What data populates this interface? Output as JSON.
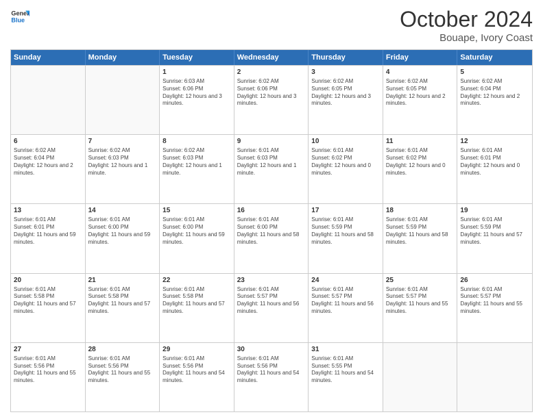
{
  "header": {
    "logo_general": "General",
    "logo_blue": "Blue",
    "month": "October 2024",
    "location": "Bouape, Ivory Coast"
  },
  "days_of_week": [
    "Sunday",
    "Monday",
    "Tuesday",
    "Wednesday",
    "Thursday",
    "Friday",
    "Saturday"
  ],
  "rows": [
    [
      {
        "day": "",
        "empty": true
      },
      {
        "day": "",
        "empty": true
      },
      {
        "day": "1",
        "sunrise": "Sunrise: 6:03 AM",
        "sunset": "Sunset: 6:06 PM",
        "daylight": "Daylight: 12 hours and 3 minutes."
      },
      {
        "day": "2",
        "sunrise": "Sunrise: 6:02 AM",
        "sunset": "Sunset: 6:06 PM",
        "daylight": "Daylight: 12 hours and 3 minutes."
      },
      {
        "day": "3",
        "sunrise": "Sunrise: 6:02 AM",
        "sunset": "Sunset: 6:05 PM",
        "daylight": "Daylight: 12 hours and 3 minutes."
      },
      {
        "day": "4",
        "sunrise": "Sunrise: 6:02 AM",
        "sunset": "Sunset: 6:05 PM",
        "daylight": "Daylight: 12 hours and 2 minutes."
      },
      {
        "day": "5",
        "sunrise": "Sunrise: 6:02 AM",
        "sunset": "Sunset: 6:04 PM",
        "daylight": "Daylight: 12 hours and 2 minutes."
      }
    ],
    [
      {
        "day": "6",
        "sunrise": "Sunrise: 6:02 AM",
        "sunset": "Sunset: 6:04 PM",
        "daylight": "Daylight: 12 hours and 2 minutes."
      },
      {
        "day": "7",
        "sunrise": "Sunrise: 6:02 AM",
        "sunset": "Sunset: 6:03 PM",
        "daylight": "Daylight: 12 hours and 1 minute."
      },
      {
        "day": "8",
        "sunrise": "Sunrise: 6:02 AM",
        "sunset": "Sunset: 6:03 PM",
        "daylight": "Daylight: 12 hours and 1 minute."
      },
      {
        "day": "9",
        "sunrise": "Sunrise: 6:01 AM",
        "sunset": "Sunset: 6:03 PM",
        "daylight": "Daylight: 12 hours and 1 minute."
      },
      {
        "day": "10",
        "sunrise": "Sunrise: 6:01 AM",
        "sunset": "Sunset: 6:02 PM",
        "daylight": "Daylight: 12 hours and 0 minutes."
      },
      {
        "day": "11",
        "sunrise": "Sunrise: 6:01 AM",
        "sunset": "Sunset: 6:02 PM",
        "daylight": "Daylight: 12 hours and 0 minutes."
      },
      {
        "day": "12",
        "sunrise": "Sunrise: 6:01 AM",
        "sunset": "Sunset: 6:01 PM",
        "daylight": "Daylight: 12 hours and 0 minutes."
      }
    ],
    [
      {
        "day": "13",
        "sunrise": "Sunrise: 6:01 AM",
        "sunset": "Sunset: 6:01 PM",
        "daylight": "Daylight: 11 hours and 59 minutes."
      },
      {
        "day": "14",
        "sunrise": "Sunrise: 6:01 AM",
        "sunset": "Sunset: 6:00 PM",
        "daylight": "Daylight: 11 hours and 59 minutes."
      },
      {
        "day": "15",
        "sunrise": "Sunrise: 6:01 AM",
        "sunset": "Sunset: 6:00 PM",
        "daylight": "Daylight: 11 hours and 59 minutes."
      },
      {
        "day": "16",
        "sunrise": "Sunrise: 6:01 AM",
        "sunset": "Sunset: 6:00 PM",
        "daylight": "Daylight: 11 hours and 58 minutes."
      },
      {
        "day": "17",
        "sunrise": "Sunrise: 6:01 AM",
        "sunset": "Sunset: 5:59 PM",
        "daylight": "Daylight: 11 hours and 58 minutes."
      },
      {
        "day": "18",
        "sunrise": "Sunrise: 6:01 AM",
        "sunset": "Sunset: 5:59 PM",
        "daylight": "Daylight: 11 hours and 58 minutes."
      },
      {
        "day": "19",
        "sunrise": "Sunrise: 6:01 AM",
        "sunset": "Sunset: 5:59 PM",
        "daylight": "Daylight: 11 hours and 57 minutes."
      }
    ],
    [
      {
        "day": "20",
        "sunrise": "Sunrise: 6:01 AM",
        "sunset": "Sunset: 5:58 PM",
        "daylight": "Daylight: 11 hours and 57 minutes."
      },
      {
        "day": "21",
        "sunrise": "Sunrise: 6:01 AM",
        "sunset": "Sunset: 5:58 PM",
        "daylight": "Daylight: 11 hours and 57 minutes."
      },
      {
        "day": "22",
        "sunrise": "Sunrise: 6:01 AM",
        "sunset": "Sunset: 5:58 PM",
        "daylight": "Daylight: 11 hours and 57 minutes."
      },
      {
        "day": "23",
        "sunrise": "Sunrise: 6:01 AM",
        "sunset": "Sunset: 5:57 PM",
        "daylight": "Daylight: 11 hours and 56 minutes."
      },
      {
        "day": "24",
        "sunrise": "Sunrise: 6:01 AM",
        "sunset": "Sunset: 5:57 PM",
        "daylight": "Daylight: 11 hours and 56 minutes."
      },
      {
        "day": "25",
        "sunrise": "Sunrise: 6:01 AM",
        "sunset": "Sunset: 5:57 PM",
        "daylight": "Daylight: 11 hours and 55 minutes."
      },
      {
        "day": "26",
        "sunrise": "Sunrise: 6:01 AM",
        "sunset": "Sunset: 5:57 PM",
        "daylight": "Daylight: 11 hours and 55 minutes."
      }
    ],
    [
      {
        "day": "27",
        "sunrise": "Sunrise: 6:01 AM",
        "sunset": "Sunset: 5:56 PM",
        "daylight": "Daylight: 11 hours and 55 minutes."
      },
      {
        "day": "28",
        "sunrise": "Sunrise: 6:01 AM",
        "sunset": "Sunset: 5:56 PM",
        "daylight": "Daylight: 11 hours and 55 minutes."
      },
      {
        "day": "29",
        "sunrise": "Sunrise: 6:01 AM",
        "sunset": "Sunset: 5:56 PM",
        "daylight": "Daylight: 11 hours and 54 minutes."
      },
      {
        "day": "30",
        "sunrise": "Sunrise: 6:01 AM",
        "sunset": "Sunset: 5:56 PM",
        "daylight": "Daylight: 11 hours and 54 minutes."
      },
      {
        "day": "31",
        "sunrise": "Sunrise: 6:01 AM",
        "sunset": "Sunset: 5:55 PM",
        "daylight": "Daylight: 11 hours and 54 minutes."
      },
      {
        "day": "",
        "empty": true
      },
      {
        "day": "",
        "empty": true
      }
    ]
  ]
}
